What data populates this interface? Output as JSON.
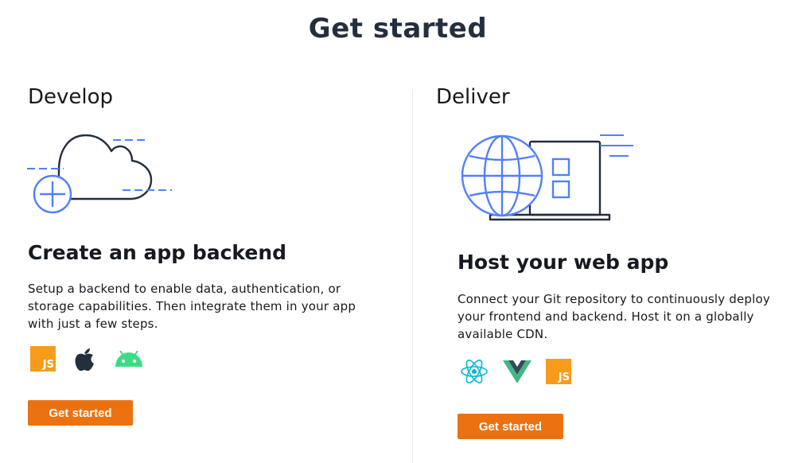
{
  "page": {
    "title": "Get started"
  },
  "develop": {
    "heading": "Develop",
    "card_title": "Create an app backend",
    "description": "Setup a backend to enable data, authentication, or storage capabilities. Then integrate them in your app with just a few steps.",
    "platform_icons": [
      "javascript-icon",
      "apple-icon",
      "android-icon"
    ],
    "js_label": "JS",
    "button_label": "Get started"
  },
  "deliver": {
    "heading": "Deliver",
    "card_title": "Host your web app",
    "description": "Connect your Git repository to continuously deploy your frontend and backend. Host it on a globally available CDN.",
    "framework_icons": [
      "react-icon",
      "vue-icon",
      "javascript-icon"
    ],
    "js_label": "JS",
    "button_label": "Get started"
  },
  "colors": {
    "accent": "#ec7211",
    "illustration_blue": "#527fff",
    "illustration_dark": "#232f3e",
    "js_orange": "#f89b1c",
    "android_green": "#3ddc84",
    "react_cyan": "#00b7d9",
    "vue_green": "#41b883",
    "vue_dark": "#34495e"
  }
}
